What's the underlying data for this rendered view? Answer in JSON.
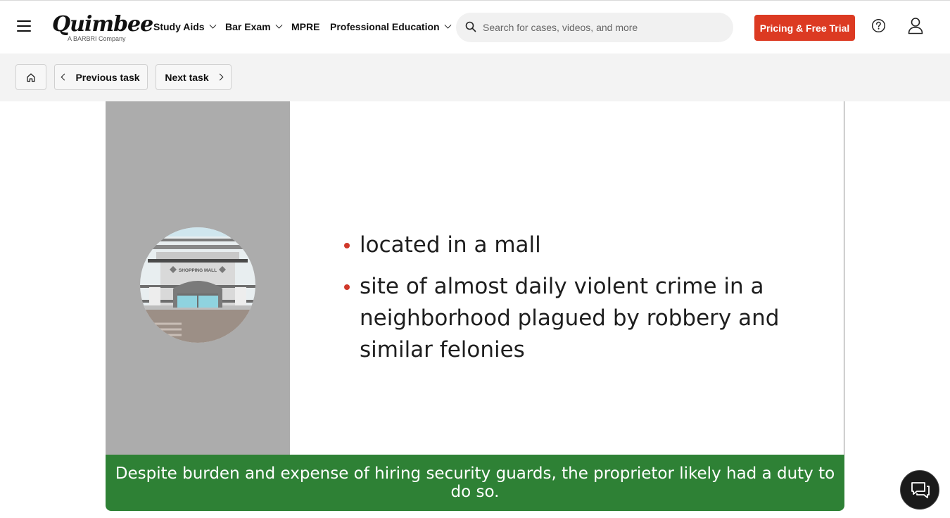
{
  "header": {
    "logo": {
      "wordmark": "Quimbee",
      "tagline": "A BARBRI Company"
    },
    "nav": [
      {
        "label": "Study Aids",
        "has_dropdown": true
      },
      {
        "label": "Bar Exam",
        "has_dropdown": true
      },
      {
        "label": "MPRE",
        "has_dropdown": false
      },
      {
        "label": "Professional Education",
        "has_dropdown": true
      }
    ],
    "search": {
      "placeholder": "Search for cases, videos, and more",
      "value": ""
    },
    "cta_label": "Pricing & Free Trial",
    "icons": {
      "menu": "hamburger-icon",
      "help": "help-circle-icon",
      "account": "user-icon",
      "search": "search-icon"
    }
  },
  "subnav": {
    "home_icon": "home-icon",
    "previous_label": "Previous task",
    "next_label": "Next task"
  },
  "slide": {
    "illustration_label": "SHOPPING MALL",
    "bullets": [
      "located in a mall",
      "site of almost daily violent crime in a neighborhood plagued by robbery and similar felonies"
    ],
    "caption": "Despite burden and expense of hiring security guards, the proprietor likely had a duty to do so."
  },
  "chat_icon": "chat-bubble-icon",
  "colors": {
    "accent": "#dc3a22",
    "caption_bg": "#2e8135",
    "bullet": "#d0382a",
    "panel_gray": "#acacac"
  }
}
